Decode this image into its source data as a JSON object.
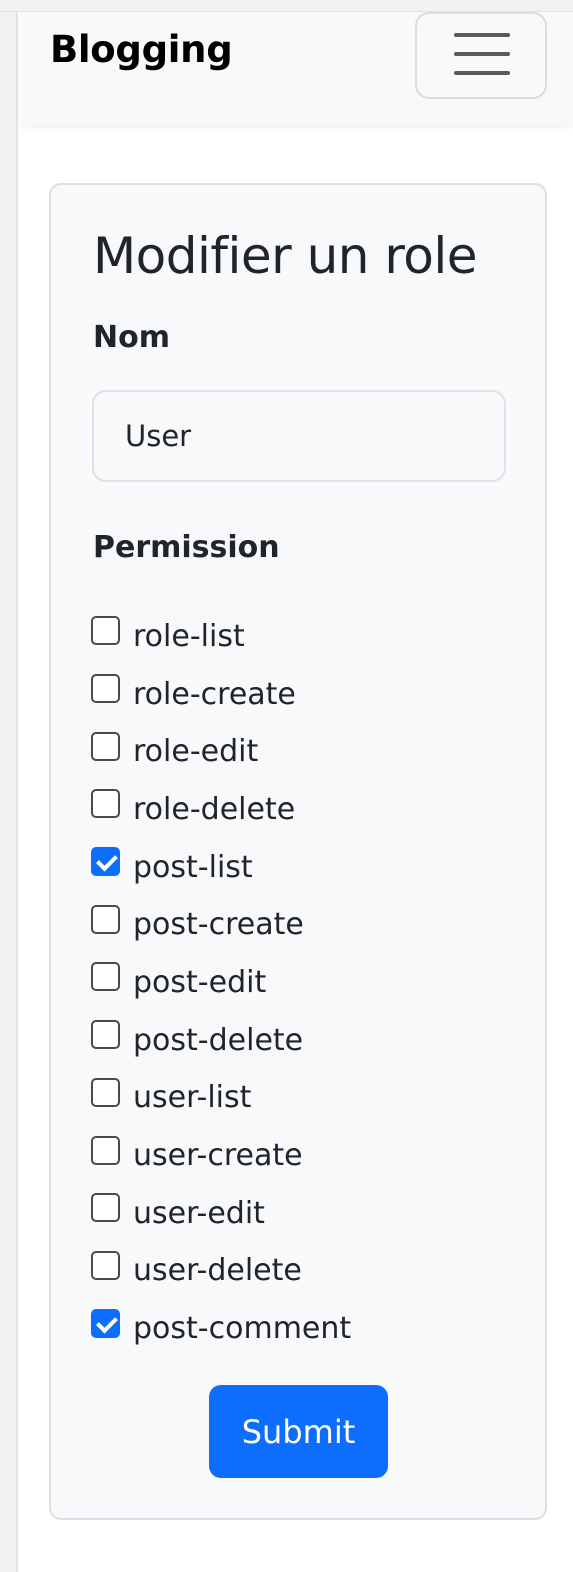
{
  "navbar": {
    "brand": "Blogging",
    "toggler_icon": "menu-hamburger-icon"
  },
  "form": {
    "title": "Modifier un role",
    "name_label": "Nom",
    "name_value": "User",
    "permission_label": "Permission",
    "permissions": [
      {
        "label": "role-list",
        "checked": false
      },
      {
        "label": "role-create",
        "checked": false
      },
      {
        "label": "role-edit",
        "checked": false
      },
      {
        "label": "role-delete",
        "checked": false
      },
      {
        "label": "post-list",
        "checked": true
      },
      {
        "label": "post-create",
        "checked": false
      },
      {
        "label": "post-edit",
        "checked": false
      },
      {
        "label": "post-delete",
        "checked": false
      },
      {
        "label": "user-list",
        "checked": false
      },
      {
        "label": "user-create",
        "checked": false
      },
      {
        "label": "user-edit",
        "checked": false
      },
      {
        "label": "user-delete",
        "checked": false
      },
      {
        "label": "post-comment",
        "checked": true
      }
    ],
    "submit_label": "Submit"
  },
  "colors": {
    "primary": "#0d6efd",
    "card_bg": "#f8f9fa",
    "text": "#212529"
  }
}
